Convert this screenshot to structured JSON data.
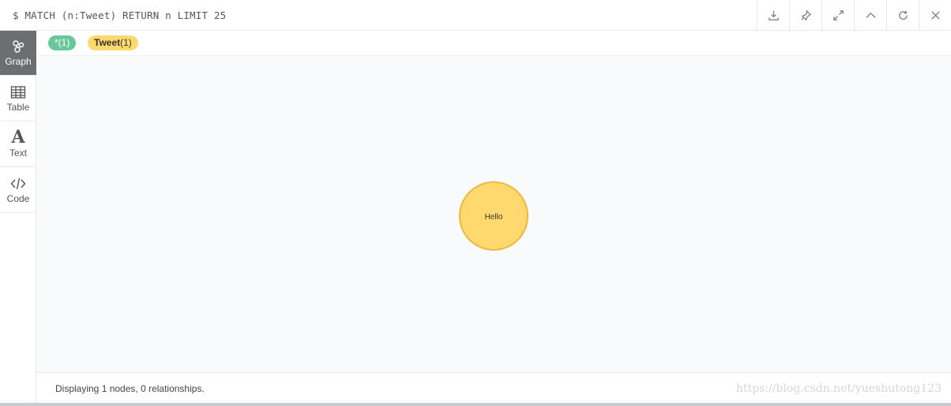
{
  "query": {
    "text": "$ MATCH (n:Tweet) RETURN n LIMIT 25"
  },
  "toolbar": {
    "buttons": [
      {
        "icon": "download-icon"
      },
      {
        "icon": "pin-icon"
      },
      {
        "icon": "expand-icon"
      },
      {
        "icon": "chevron-up-icon"
      },
      {
        "icon": "refresh-icon"
      },
      {
        "icon": "close-icon"
      }
    ]
  },
  "sidebar": {
    "items": [
      {
        "label": "Graph",
        "icon": "graph-icon",
        "active": true
      },
      {
        "label": "Table",
        "icon": "table-icon"
      },
      {
        "label": "Text",
        "icon": "text-icon"
      },
      {
        "label": "Code",
        "icon": "code-icon"
      }
    ]
  },
  "chips": {
    "all": "*(1)",
    "tweet_name": "Tweet",
    "tweet_count": "(1)"
  },
  "graph": {
    "nodes": [
      {
        "label": "Hello",
        "fill": "#ffd86e",
        "stroke": "#ebb93f"
      }
    ]
  },
  "status": "Displaying 1 nodes, 0 relationships.",
  "watermark": "https://blog.csdn.net/yueshutong123",
  "colors": {
    "chip_all": "#68c89a",
    "chip_tweet": "#ffd86e",
    "sidebar_active": "#6d6e71"
  }
}
